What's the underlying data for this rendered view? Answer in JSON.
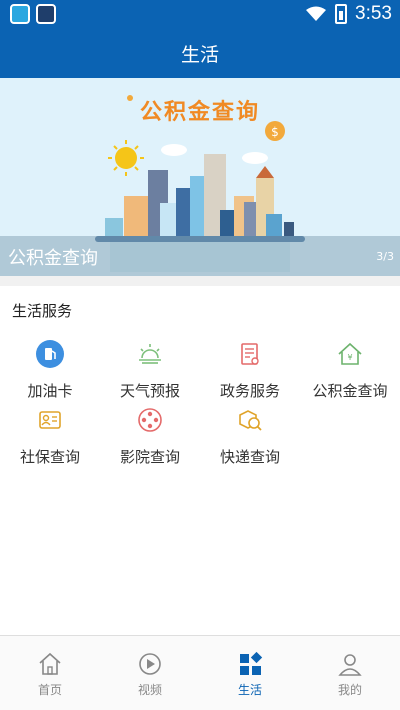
{
  "status_bar": {
    "time": "3:53"
  },
  "header": {
    "title": "生活"
  },
  "banner": {
    "title": "公积金查询",
    "caption": "公积金查询",
    "page_indicator": "3/3"
  },
  "section": {
    "title": "生活服务"
  },
  "services": [
    {
      "label": "加油卡",
      "icon": "gas-card-icon",
      "color": "#3d8fe0"
    },
    {
      "label": "天气预报",
      "icon": "weather-icon",
      "color": "#7dc07b"
    },
    {
      "label": "政务服务",
      "icon": "government-doc-icon",
      "color": "#e46a6a"
    },
    {
      "label": "公积金查询",
      "icon": "housing-fund-icon",
      "color": "#6db36d"
    },
    {
      "label": "社保查询",
      "icon": "social-security-icon",
      "color": "#e0a42a"
    },
    {
      "label": "影院查询",
      "icon": "cinema-reel-icon",
      "color": "#e46a6a"
    },
    {
      "label": "快递查询",
      "icon": "express-search-icon",
      "color": "#e0a42a"
    }
  ],
  "bottom_nav": [
    {
      "label": "首页",
      "icon": "home-icon",
      "active": false
    },
    {
      "label": "视频",
      "icon": "video-play-icon",
      "active": false
    },
    {
      "label": "生活",
      "icon": "life-grid-icon",
      "active": true
    },
    {
      "label": "我的",
      "icon": "profile-icon",
      "active": false
    }
  ],
  "colors": {
    "primary": "#0b63b3",
    "banner_title": "#f08a24",
    "inactive": "#888888"
  }
}
